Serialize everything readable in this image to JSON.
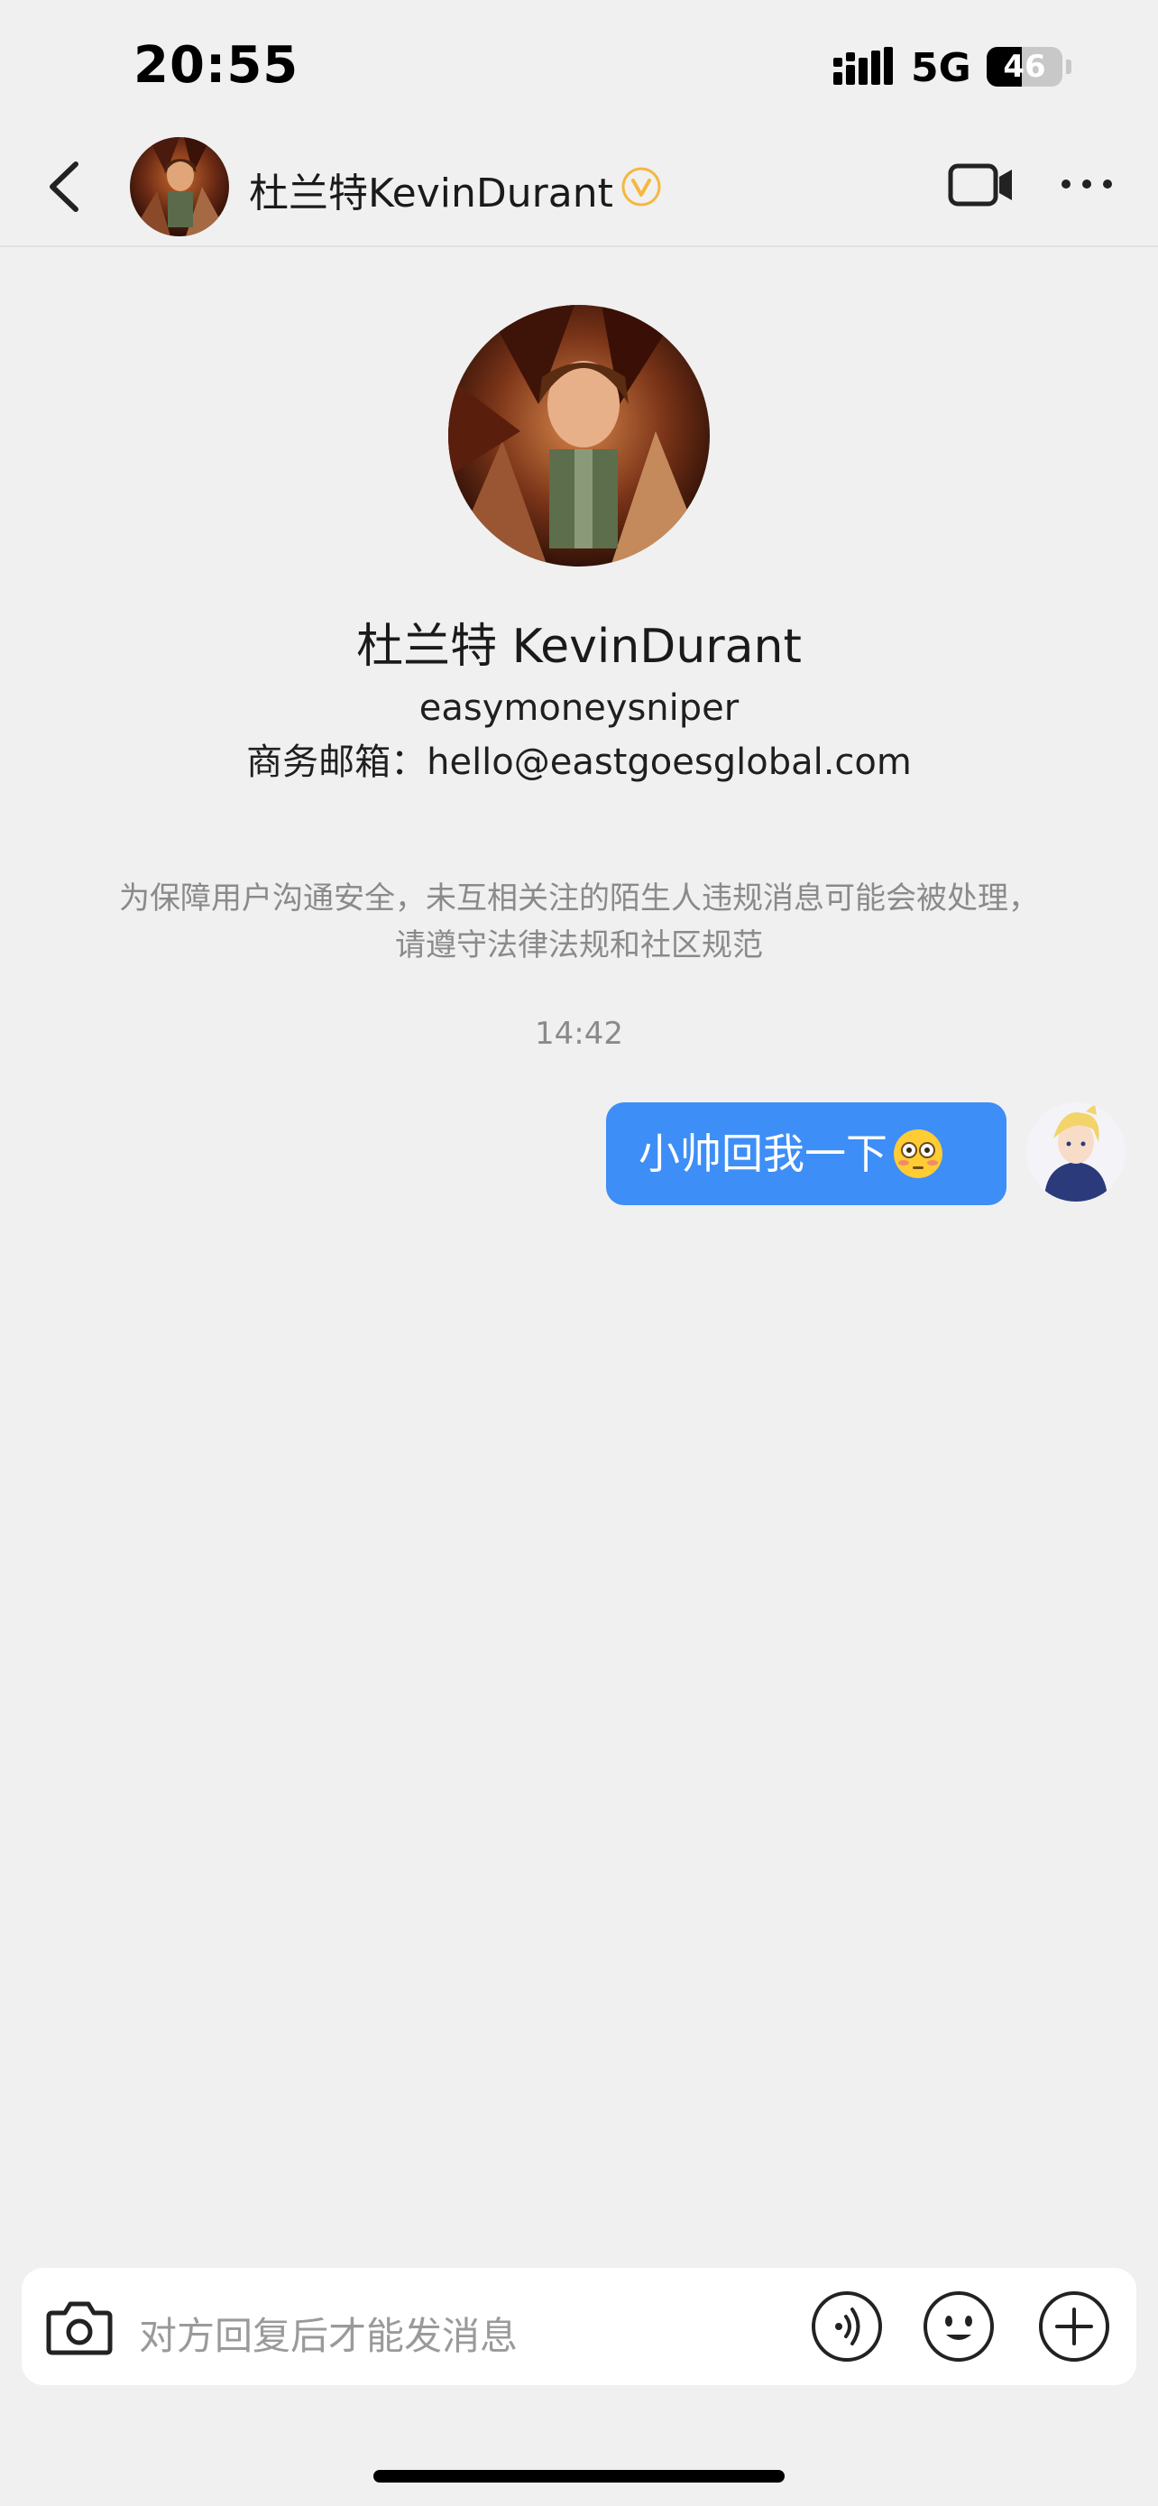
{
  "status_bar": {
    "time": "20:55",
    "network": "5G",
    "battery": "46",
    "battery_level": 0.46
  },
  "nav": {
    "back_icon": "chevron-left-icon",
    "name": "杜兰特KevinDurant",
    "verified_icon": "verified-badge-icon",
    "video_icon": "video-camera-icon",
    "more_icon": "more-dots-icon"
  },
  "profile": {
    "name": "杜兰特 KevinDurant",
    "handle": "easymoneysniper",
    "email_line": "商务邮箱：hello@eastgoesglobal.com"
  },
  "chat": {
    "notice": "为保障用户沟通安全，未互相关注的陌生人违规消息可能会被处理，请遵守法律法规和社区规范",
    "timestamp": "14:42",
    "messages": [
      {
        "from": "self",
        "text": "小帅回我一下",
        "emoji": "flushed-face"
      }
    ]
  },
  "input": {
    "placeholder": "对方回复后才能发消息",
    "camera_icon": "camera-icon",
    "voice_icon": "voice-icon",
    "emoji_icon": "smiley-icon",
    "plus_icon": "plus-circle-icon"
  },
  "colors": {
    "background": "#f0f0f0",
    "bubble": "#3d8ef7",
    "verified": "#f5b740",
    "muted_text": "#8a8a8a"
  }
}
